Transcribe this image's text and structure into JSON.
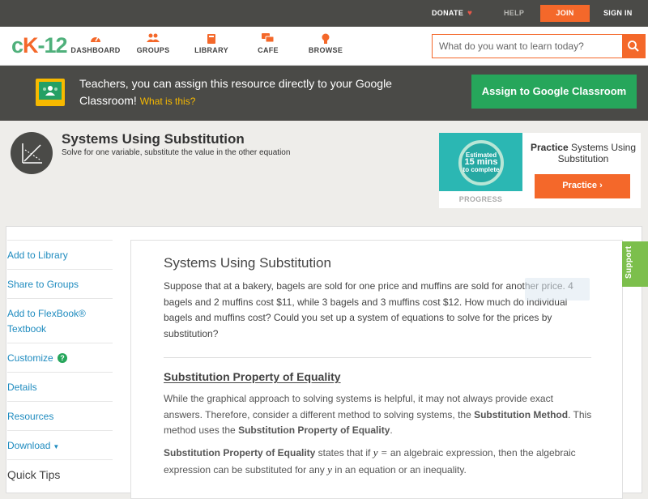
{
  "topbar": {
    "donate": "DONATE",
    "help": "HELP",
    "join": "JOIN",
    "signin": "SIGN IN"
  },
  "nav": {
    "logo": {
      "part1": "c",
      "part2": "K",
      "part3": "-12"
    },
    "items": [
      {
        "label": "DASHBOARD",
        "icon": "speedometer-icon"
      },
      {
        "label": "GROUPS",
        "icon": "people-icon"
      },
      {
        "label": "LIBRARY",
        "icon": "book-icon"
      },
      {
        "label": "CAFE",
        "icon": "chat-icon"
      },
      {
        "label": "BROWSE",
        "icon": "lightbulb-icon"
      }
    ],
    "search_placeholder": "What do you want to learn today?"
  },
  "classroom_banner": {
    "text": "Teachers, you can assign this resource directly to your Google Classroom!",
    "link": "What is this?",
    "button": "Assign to Google Classroom"
  },
  "concept": {
    "title": "Systems Using Substitution",
    "subtitle": "Solve for one variable, substitute the value in the other equation"
  },
  "practice_card": {
    "estimate_line1": "Estimated",
    "estimate_line2": "15 mins",
    "estimate_line3": "to complete",
    "progress_label": "PROGRESS",
    "title_bold": "Practice",
    "title_rest": "Systems Using Substitution",
    "button": "Practice"
  },
  "sidebar": {
    "items": [
      "Add to Library",
      "Share to Groups",
      "Add to FlexBook® Textbook",
      "Customize",
      "Details",
      "Resources",
      "Download",
      "Quick Tips"
    ]
  },
  "article": {
    "title": "Systems Using Substitution",
    "intro": "Suppose that at a bakery, bagels are sold for one price and muffins are sold for another price. 4 bagels and 2 muffins cost $11, while 3 bagels and 3 muffins cost $12. How much do individual bagels and muffins cost? Could you set up a system of equations to solve for the prices by substitution?",
    "heading": "Substitution Property of Equality",
    "p1_a": "While the graphical approach to solving systems is helpful, it may not always provide exact answers. Therefore, consider a different method to solving systems, the ",
    "p1_b": "Substitution Method",
    "p1_c": ". This method uses the ",
    "p1_d": "Substitution Property of Equality",
    "p1_e": ".",
    "p2_a": "Substitution Property of Equality",
    "p2_b": " states that if ",
    "p2_math1": "y =",
    "p2_c": " an algebraic expression, then the algebraic expression can be substituted for any ",
    "p2_math2": "y",
    "p2_d": " in an equation or an inequality."
  },
  "support_tab": "Support"
}
